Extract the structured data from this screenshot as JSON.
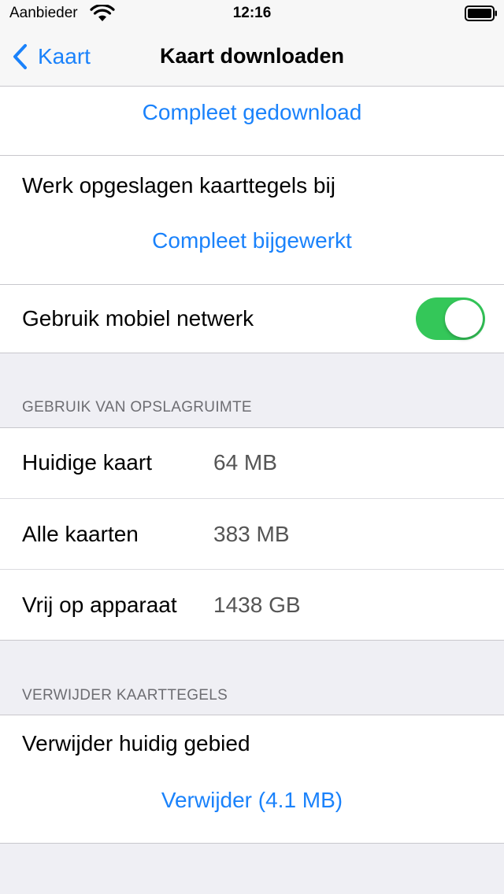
{
  "status_bar": {
    "carrier": "Aanbieder",
    "time": "12:16"
  },
  "nav": {
    "back_label": "Kaart",
    "title": "Kaart downloaden"
  },
  "download": {
    "status_link": "Compleet gedownload"
  },
  "update": {
    "label": "Werk opgeslagen kaarttegels bij",
    "status_link": "Compleet bijgewerkt"
  },
  "mobile_network": {
    "label": "Gebruik mobiel netwerk",
    "enabled": true
  },
  "storage": {
    "header": "GEBRUIK VAN OPSLAGRUIMTE",
    "rows": [
      {
        "label": "Huidige kaart",
        "value": "64 MB"
      },
      {
        "label": "Alle kaarten",
        "value": "383 MB"
      },
      {
        "label": "Vrij op apparaat",
        "value": "1438 GB"
      }
    ]
  },
  "delete": {
    "header": "VERWIJDER KAARTTEGELS",
    "label": "Verwijder huidig gebied",
    "button": "Verwijder (4.1 MB)"
  },
  "colors": {
    "accent": "#1a82fb",
    "toggle_on": "#34c759",
    "background": "#efeff4"
  }
}
